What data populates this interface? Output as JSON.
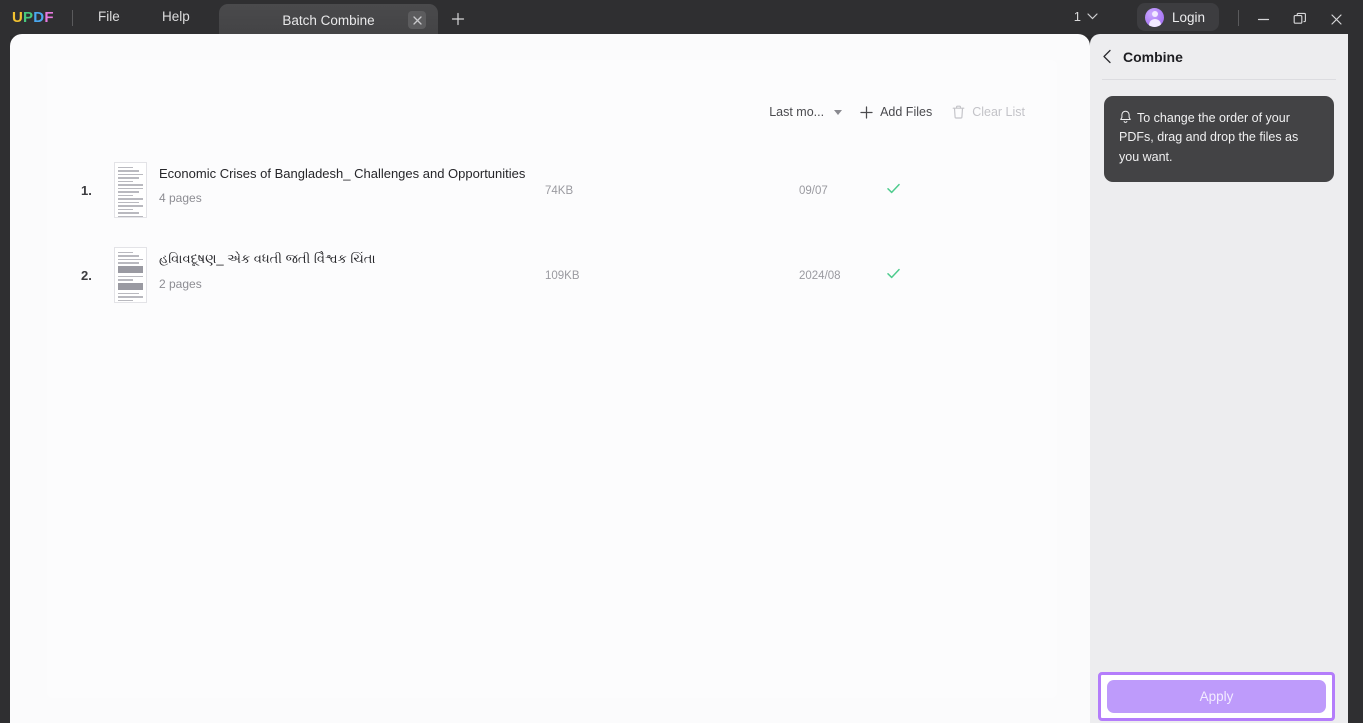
{
  "titlebar": {
    "logo": [
      {
        "ch": "U",
        "color": "#f2c230"
      },
      {
        "ch": "P",
        "color": "#47c97e"
      },
      {
        "ch": "D",
        "color": "#4aa8f0"
      },
      {
        "ch": "F",
        "color": "#e87ae0"
      }
    ],
    "menus": [
      {
        "label": "File"
      },
      {
        "label": "Help"
      }
    ],
    "tab": {
      "label": "Batch Combine",
      "close_icon": "close-icon",
      "new_tab_icon": "plus-icon"
    },
    "zoom": {
      "value": "1",
      "icon": "chevron-down-icon"
    },
    "login": {
      "label": "Login",
      "avatar_icon": "user-avatar-icon"
    },
    "window_controls": {
      "minimize_icon": "minimize-icon",
      "restore_icon": "restore-icon",
      "close_icon": "close-icon"
    }
  },
  "toolbar": {
    "sort": {
      "label": "Last mo...",
      "icon": "chevron-down-icon"
    },
    "add_files": {
      "label": "Add Files",
      "icon": "plus-icon"
    },
    "clear_list": {
      "label": "Clear List",
      "icon": "trash-icon",
      "disabled": true
    }
  },
  "files": [
    {
      "index": "1.",
      "title": "Economic Crises of Bangladesh_ Challenges and Opportunities",
      "pages": "4 pages",
      "size": "74KB",
      "date": "09/07",
      "status_icon": "check-icon"
    },
    {
      "index": "2.",
      "title": "હવાિવદૂષણ_ એક વધતી જતી વૈિશ્વક ચિંતા",
      "pages": "2 pages",
      "size": "109KB",
      "date": "2024/08",
      "status_icon": "check-icon"
    }
  ],
  "sidebar": {
    "back_icon": "chevron-left-icon",
    "title": "Combine",
    "notice": {
      "icon": "bell-icon",
      "text": "To change the order of your PDFs, drag and drop the files as you want."
    },
    "apply": {
      "label": "Apply"
    }
  },
  "colors": {
    "accent_purple": "#be9bfb",
    "highlight_border": "#b47dfb",
    "check_green": "#4ecb8d",
    "titlebar_bg": "#2f2f31",
    "sidebar_bg": "#ededef",
    "panel_bg": "#fbfbfc"
  }
}
